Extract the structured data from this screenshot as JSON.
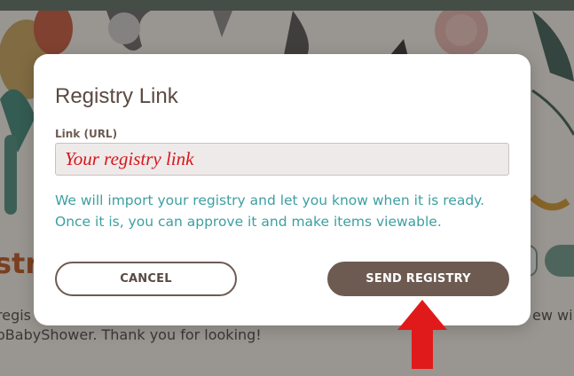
{
  "background": {
    "heading_fragment": "stry",
    "text_line_1": "regis",
    "text_line_2": "oBabyShower. Thank you for looking!",
    "text_right": "ew wi"
  },
  "modal": {
    "title": "Registry Link",
    "field_label": "Link (URL)",
    "url_placeholder": "Your registry link",
    "url_value": "",
    "info_line_1": "We will import your registry and let you know when it is ready.",
    "info_line_2": "Once it is, you can approve it and make items viewable.",
    "cancel_label": "CANCEL",
    "send_label": "SEND REGISTRY"
  },
  "annotation": {
    "icon": "red-up-arrow-icon",
    "color": "#e01a1a"
  },
  "colors": {
    "brown": "#6d5b52",
    "teal_text": "#3d9fa1",
    "placeholder_red": "#d8161a"
  }
}
